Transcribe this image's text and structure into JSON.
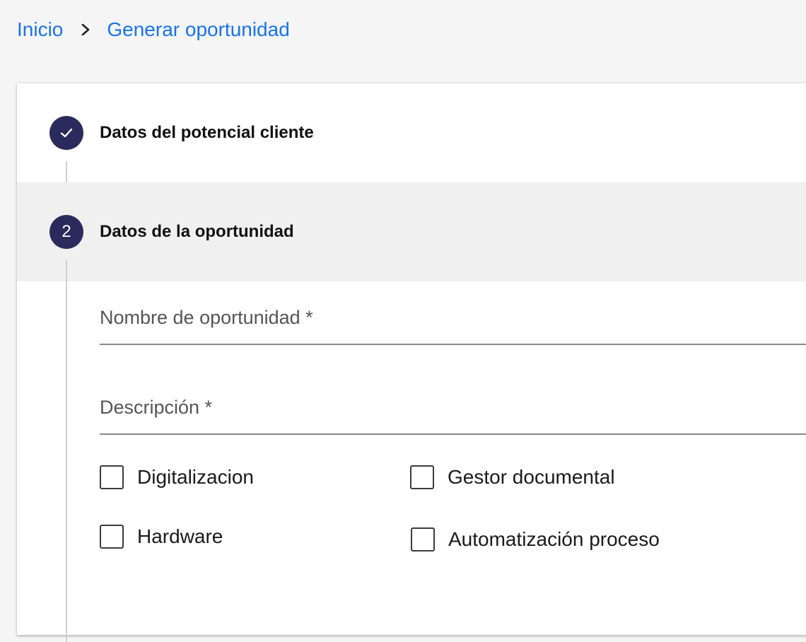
{
  "breadcrumb": {
    "home": "Inicio",
    "current": "Generar oportunidad"
  },
  "stepper": {
    "steps": [
      {
        "label": "Datos del potencial cliente",
        "state": "completed",
        "icon": "check-icon"
      },
      {
        "label": "Datos de la oportunidad",
        "state": "active",
        "number": "2"
      }
    ]
  },
  "form": {
    "name_label": "Nombre de oportunidad *",
    "description_label": "Descripción *",
    "checkboxes": [
      {
        "label": "Digitalizacion",
        "checked": false
      },
      {
        "label": "Gestor documental",
        "checked": false
      },
      {
        "label": "Hardware",
        "checked": false
      },
      {
        "label": "Automatización proceso",
        "checked": false
      }
    ]
  },
  "colors": {
    "link": "#1a73e8",
    "step_circle": "#2b2a5c",
    "active_step_bg": "#f0f0f0"
  }
}
